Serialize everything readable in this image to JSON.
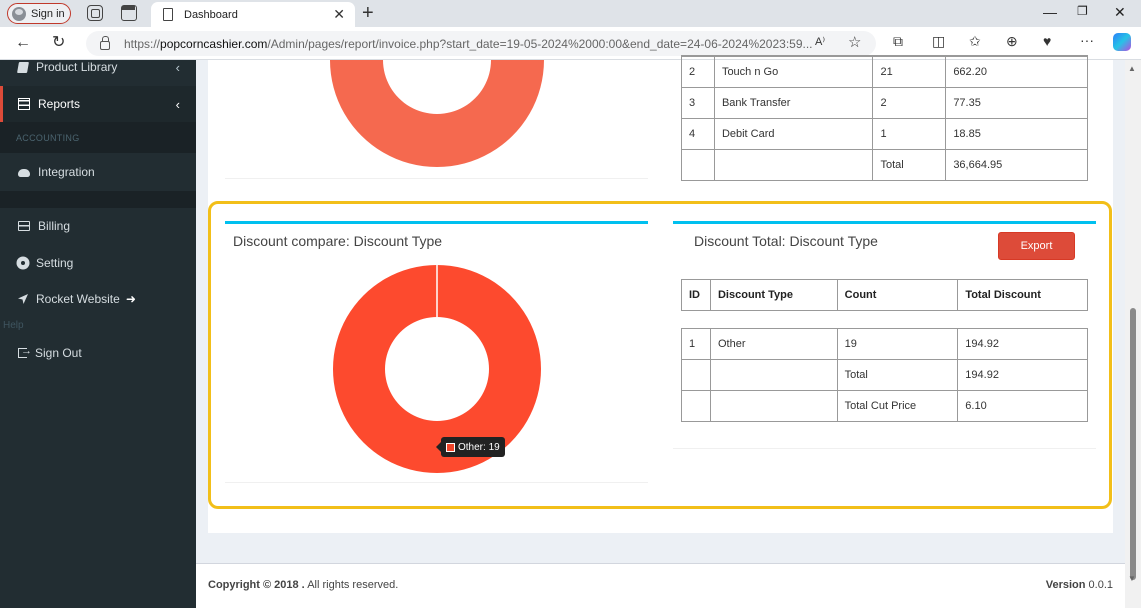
{
  "browser": {
    "signin_label": "Sign in",
    "tab_title": "Dashboard",
    "url_prefix": "https://",
    "url_domain": "popcorncashier.com",
    "url_path": "/Admin/pages/report/invoice.php?start_date=19-05-2024%2000:00&end_date=24-06-2024%2023:59..."
  },
  "sidebar": {
    "items": [
      {
        "label": "Product Library"
      },
      {
        "label": "Reports"
      },
      {
        "label": "Integration"
      },
      {
        "label": "Billing"
      },
      {
        "label": "Setting"
      },
      {
        "label": "Rocket Website"
      },
      {
        "label": "Sign Out"
      }
    ],
    "header_accounting": "ACCOUNTING",
    "faded_text": "Help"
  },
  "payment_table": {
    "rows": [
      {
        "id": "2",
        "type": "Touch n Go",
        "count": "21",
        "amount": "662.20"
      },
      {
        "id": "3",
        "type": "Bank Transfer",
        "count": "2",
        "amount": "77.35"
      },
      {
        "id": "4",
        "type": "Debit Card",
        "count": "1",
        "amount": "18.85"
      },
      {
        "id": "",
        "type": "",
        "count": "Total",
        "amount": "36,664.95"
      }
    ]
  },
  "discount_chart": {
    "title": "Discount compare: Discount Type",
    "tooltip": "Other: 19"
  },
  "discount_total": {
    "title": "Discount Total: Discount Type",
    "export_label": "Export",
    "headers": [
      "ID",
      "Discount Type",
      "Count",
      "Total Discount"
    ],
    "rows": [
      {
        "id": "1",
        "type": "Other",
        "count": "19",
        "total": "194.92"
      },
      {
        "id": "",
        "type": "",
        "count": "Total",
        "total": "194.92"
      },
      {
        "id": "",
        "type": "",
        "count": "Total Cut Price",
        "total": "6.10"
      }
    ]
  },
  "footer": {
    "copyright_bold": "Copyright © 2018 .",
    "copyright_rest": " All rights reserved.",
    "version_label": "Version",
    "version_value": " 0.0.1"
  },
  "chart_data": [
    {
      "type": "pie",
      "donut": true,
      "labels": [
        "Other"
      ],
      "values": [
        19
      ],
      "colors": [
        "#f5694f"
      ],
      "note": "upper donut partially visible"
    },
    {
      "type": "pie",
      "donut": true,
      "labels": [
        "Other"
      ],
      "values": [
        19
      ],
      "colors": [
        "#fd4a2e"
      ]
    }
  ]
}
